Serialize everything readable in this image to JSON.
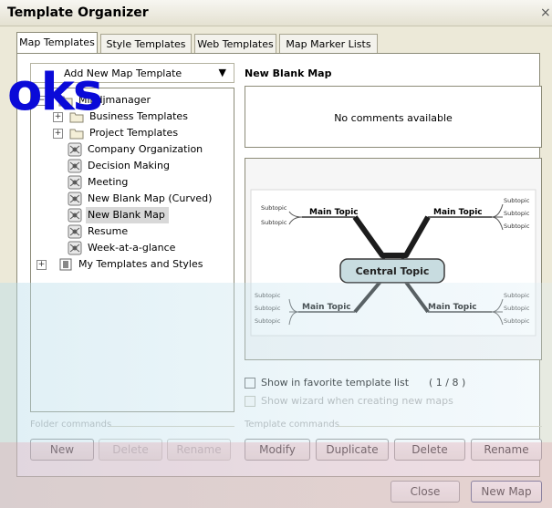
{
  "window": {
    "title": "Template Organizer",
    "close_glyph": "×"
  },
  "tabs": [
    {
      "label": "Map Templates",
      "active": true
    },
    {
      "label": "Style Templates",
      "active": false
    },
    {
      "label": "Web Templates",
      "active": false
    },
    {
      "label": "Map Marker Lists",
      "active": false
    }
  ],
  "overlay": {
    "text": "oks"
  },
  "left": {
    "dropdown_label": "Add New Map Template",
    "tree": [
      {
        "label": "Mindjmanager",
        "indent": 0,
        "expander": "−",
        "icon": "folder"
      },
      {
        "label": "Business Templates",
        "indent": 1,
        "expander": "+",
        "icon": "folder"
      },
      {
        "label": "Project Templates",
        "indent": 1,
        "expander": "+",
        "icon": "folder"
      },
      {
        "label": "Company Organization",
        "indent": 2,
        "expander": "",
        "icon": "map-template"
      },
      {
        "label": "Decision Making",
        "indent": 2,
        "expander": "",
        "icon": "map-template"
      },
      {
        "label": "Meeting",
        "indent": 2,
        "expander": "",
        "icon": "map-template"
      },
      {
        "label": "New Blank Map (Curved)",
        "indent": 2,
        "expander": "",
        "icon": "map-template"
      },
      {
        "label": "New Blank Map",
        "indent": 2,
        "expander": "",
        "icon": "map-template",
        "selected": true
      },
      {
        "label": "Resume",
        "indent": 2,
        "expander": "",
        "icon": "map-template"
      },
      {
        "label": "Week-at-a-glance",
        "indent": 2,
        "expander": "",
        "icon": "map-template"
      },
      {
        "label": "My Templates and Styles",
        "indent": 0,
        "expander": "+",
        "icon": "folder-grid"
      }
    ],
    "folder_commands": {
      "label": "Folder commands",
      "buttons": [
        {
          "label": "New",
          "enabled": true
        },
        {
          "label": "Delete",
          "enabled": false
        },
        {
          "label": "Rename",
          "enabled": false
        }
      ]
    }
  },
  "right": {
    "template_name": "New Blank Map",
    "comments": "No comments available",
    "preview": {
      "central": "Central Topic",
      "main_topics": [
        "Main Topic",
        "Main Topic",
        "Main Topic",
        "Main Topic"
      ],
      "subtopic": "Subtopic"
    },
    "favorite_label": "Show in favorite template list",
    "count": "( 1 / 8 )",
    "wizard_label": "Show wizard when creating new maps",
    "template_commands": {
      "label": "Template commands",
      "buttons": [
        {
          "label": "Modify",
          "enabled": true
        },
        {
          "label": "Duplicate",
          "enabled": true
        },
        {
          "label": "Delete",
          "enabled": true
        },
        {
          "label": "Rename",
          "enabled": true
        }
      ]
    }
  },
  "footer": {
    "close": "Close",
    "new_map": "New Map"
  },
  "colors": {
    "accent": "#0a0ad8",
    "band_blue": "#bbdeea",
    "band_pink": "#e29caa"
  }
}
